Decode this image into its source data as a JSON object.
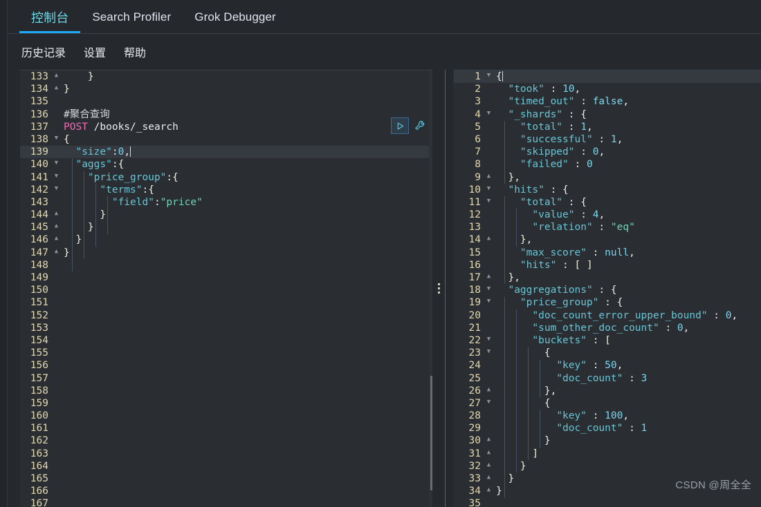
{
  "window": {
    "background": "#25282c",
    "accent": "#1ba9f5",
    "active_tab_color": "#6bd8e8"
  },
  "tabs": [
    {
      "label": "控制台",
      "active": true,
      "name": "tab-console"
    },
    {
      "label": "Search Profiler",
      "active": false,
      "name": "tab-search-profiler"
    },
    {
      "label": "Grok Debugger",
      "active": false,
      "name": "tab-grok-debugger"
    }
  ],
  "menu": [
    {
      "label": "历史记录",
      "name": "menu-history"
    },
    {
      "label": "设置",
      "name": "menu-settings"
    },
    {
      "label": "帮助",
      "name": "menu-help"
    }
  ],
  "actions": {
    "play_title": "Click to send request",
    "wrench_title": "Open documentation / options",
    "play_icon": "play-icon",
    "wrench_icon": "wrench-icon"
  },
  "request_editor": {
    "name": "request-editor",
    "first_line_number": 133,
    "highlighted_line": 139,
    "lines": [
      {
        "n": 133,
        "fold": "up",
        "tokens": [
          {
            "t": "    ",
            "c": ""
          },
          {
            "t": "}",
            "c": "c-punc"
          }
        ]
      },
      {
        "n": 134,
        "fold": "up",
        "tokens": [
          {
            "t": "}",
            "c": "c-punc"
          }
        ]
      },
      {
        "n": 135,
        "fold": "",
        "tokens": []
      },
      {
        "n": 136,
        "fold": "",
        "tokens": [
          {
            "t": "#聚合查询",
            "c": "c-cmt"
          }
        ]
      },
      {
        "n": 137,
        "fold": "",
        "tokens": [
          {
            "t": "POST",
            "c": "c-meth"
          },
          {
            "t": " /books/_search",
            "c": "c-url"
          }
        ]
      },
      {
        "n": 138,
        "fold": "down",
        "tokens": [
          {
            "t": "{",
            "c": "c-punc"
          }
        ]
      },
      {
        "n": 139,
        "fold": "",
        "tokens": [
          {
            "t": "  ",
            "c": ""
          },
          {
            "t": "\"size\"",
            "c": "c-key"
          },
          {
            "t": ":",
            "c": "c-punc"
          },
          {
            "t": "0",
            "c": "c-num"
          },
          {
            "t": ",",
            "c": "c-punc"
          }
        ],
        "caret": true
      },
      {
        "n": 140,
        "fold": "down",
        "tokens": [
          {
            "t": "  ",
            "c": ""
          },
          {
            "t": "\"aggs\"",
            "c": "c-key"
          },
          {
            "t": ":{",
            "c": "c-punc"
          }
        ]
      },
      {
        "n": 141,
        "fold": "down",
        "tokens": [
          {
            "t": "    ",
            "c": ""
          },
          {
            "t": "\"price_group\"",
            "c": "c-key"
          },
          {
            "t": ":{",
            "c": "c-punc"
          }
        ]
      },
      {
        "n": 142,
        "fold": "down",
        "tokens": [
          {
            "t": "      ",
            "c": ""
          },
          {
            "t": "\"terms\"",
            "c": "c-key"
          },
          {
            "t": ":{",
            "c": "c-punc"
          }
        ]
      },
      {
        "n": 143,
        "fold": "",
        "tokens": [
          {
            "t": "        ",
            "c": ""
          },
          {
            "t": "\"field\"",
            "c": "c-key"
          },
          {
            "t": ":",
            "c": "c-punc"
          },
          {
            "t": "\"price\"",
            "c": "c-str"
          }
        ]
      },
      {
        "n": 144,
        "fold": "up",
        "tokens": [
          {
            "t": "      ",
            "c": ""
          },
          {
            "t": "}",
            "c": "c-punc"
          }
        ]
      },
      {
        "n": 145,
        "fold": "up",
        "tokens": [
          {
            "t": "    ",
            "c": ""
          },
          {
            "t": "}",
            "c": "c-punc"
          }
        ]
      },
      {
        "n": 146,
        "fold": "up",
        "tokens": [
          {
            "t": "  ",
            "c": ""
          },
          {
            "t": "}",
            "c": "c-punc"
          }
        ]
      },
      {
        "n": 147,
        "fold": "up",
        "tokens": [
          {
            "t": "}",
            "c": "c-punc"
          }
        ]
      },
      {
        "n": 148,
        "fold": "",
        "tokens": []
      },
      {
        "n": 149,
        "fold": "",
        "tokens": []
      },
      {
        "n": 150,
        "fold": "",
        "tokens": []
      },
      {
        "n": 151,
        "fold": "",
        "tokens": []
      },
      {
        "n": 152,
        "fold": "",
        "tokens": []
      },
      {
        "n": 153,
        "fold": "",
        "tokens": []
      },
      {
        "n": 154,
        "fold": "",
        "tokens": []
      },
      {
        "n": 155,
        "fold": "",
        "tokens": []
      },
      {
        "n": 156,
        "fold": "",
        "tokens": []
      },
      {
        "n": 157,
        "fold": "",
        "tokens": []
      },
      {
        "n": 158,
        "fold": "",
        "tokens": []
      },
      {
        "n": 159,
        "fold": "",
        "tokens": []
      },
      {
        "n": 160,
        "fold": "",
        "tokens": []
      },
      {
        "n": 161,
        "fold": "",
        "tokens": []
      },
      {
        "n": 162,
        "fold": "",
        "tokens": []
      },
      {
        "n": 163,
        "fold": "",
        "tokens": []
      },
      {
        "n": 164,
        "fold": "",
        "tokens": []
      },
      {
        "n": 165,
        "fold": "",
        "tokens": []
      },
      {
        "n": 166,
        "fold": "",
        "tokens": []
      },
      {
        "n": 167,
        "fold": "",
        "tokens": []
      }
    ]
  },
  "response_editor": {
    "name": "response-editor",
    "highlighted_line": 1,
    "lines": [
      {
        "n": 1,
        "fold": "down",
        "tokens": [
          {
            "t": "{",
            "c": "c-punc"
          }
        ],
        "caret": true
      },
      {
        "n": 2,
        "fold": "",
        "tokens": [
          {
            "t": "  ",
            "c": ""
          },
          {
            "t": "\"took\"",
            "c": "c-key"
          },
          {
            "t": " : ",
            "c": "c-punc"
          },
          {
            "t": "10",
            "c": "c-num"
          },
          {
            "t": ",",
            "c": "c-punc"
          }
        ]
      },
      {
        "n": 3,
        "fold": "",
        "tokens": [
          {
            "t": "  ",
            "c": ""
          },
          {
            "t": "\"timed_out\"",
            "c": "c-key"
          },
          {
            "t": " : ",
            "c": "c-punc"
          },
          {
            "t": "false",
            "c": "c-bool"
          },
          {
            "t": ",",
            "c": "c-punc"
          }
        ]
      },
      {
        "n": 4,
        "fold": "down",
        "tokens": [
          {
            "t": "  ",
            "c": ""
          },
          {
            "t": "\"_shards\"",
            "c": "c-key"
          },
          {
            "t": " : {",
            "c": "c-punc"
          }
        ]
      },
      {
        "n": 5,
        "fold": "",
        "tokens": [
          {
            "t": "    ",
            "c": ""
          },
          {
            "t": "\"total\"",
            "c": "c-key"
          },
          {
            "t": " : ",
            "c": "c-punc"
          },
          {
            "t": "1",
            "c": "c-num"
          },
          {
            "t": ",",
            "c": "c-punc"
          }
        ]
      },
      {
        "n": 6,
        "fold": "",
        "tokens": [
          {
            "t": "    ",
            "c": ""
          },
          {
            "t": "\"successful\"",
            "c": "c-key"
          },
          {
            "t": " : ",
            "c": "c-punc"
          },
          {
            "t": "1",
            "c": "c-num"
          },
          {
            "t": ",",
            "c": "c-punc"
          }
        ]
      },
      {
        "n": 7,
        "fold": "",
        "tokens": [
          {
            "t": "    ",
            "c": ""
          },
          {
            "t": "\"skipped\"",
            "c": "c-key"
          },
          {
            "t": " : ",
            "c": "c-punc"
          },
          {
            "t": "0",
            "c": "c-num"
          },
          {
            "t": ",",
            "c": "c-punc"
          }
        ]
      },
      {
        "n": 8,
        "fold": "",
        "tokens": [
          {
            "t": "    ",
            "c": ""
          },
          {
            "t": "\"failed\"",
            "c": "c-key"
          },
          {
            "t": " : ",
            "c": "c-punc"
          },
          {
            "t": "0",
            "c": "c-num"
          }
        ]
      },
      {
        "n": 9,
        "fold": "up",
        "tokens": [
          {
            "t": "  ",
            "c": ""
          },
          {
            "t": "},",
            "c": "c-punc"
          }
        ]
      },
      {
        "n": 10,
        "fold": "down",
        "tokens": [
          {
            "t": "  ",
            "c": ""
          },
          {
            "t": "\"hits\"",
            "c": "c-key"
          },
          {
            "t": " : {",
            "c": "c-punc"
          }
        ]
      },
      {
        "n": 11,
        "fold": "down",
        "tokens": [
          {
            "t": "    ",
            "c": ""
          },
          {
            "t": "\"total\"",
            "c": "c-key"
          },
          {
            "t": " : {",
            "c": "c-punc"
          }
        ]
      },
      {
        "n": 12,
        "fold": "",
        "tokens": [
          {
            "t": "      ",
            "c": ""
          },
          {
            "t": "\"value\"",
            "c": "c-key"
          },
          {
            "t": " : ",
            "c": "c-punc"
          },
          {
            "t": "4",
            "c": "c-num"
          },
          {
            "t": ",",
            "c": "c-punc"
          }
        ]
      },
      {
        "n": 13,
        "fold": "",
        "tokens": [
          {
            "t": "      ",
            "c": ""
          },
          {
            "t": "\"relation\"",
            "c": "c-key"
          },
          {
            "t": " : ",
            "c": "c-punc"
          },
          {
            "t": "\"eq\"",
            "c": "c-str"
          }
        ]
      },
      {
        "n": 14,
        "fold": "up",
        "tokens": [
          {
            "t": "    ",
            "c": ""
          },
          {
            "t": "},",
            "c": "c-punc"
          }
        ]
      },
      {
        "n": 15,
        "fold": "",
        "tokens": [
          {
            "t": "    ",
            "c": ""
          },
          {
            "t": "\"max_score\"",
            "c": "c-key"
          },
          {
            "t": " : ",
            "c": "c-punc"
          },
          {
            "t": "null",
            "c": "c-null"
          },
          {
            "t": ",",
            "c": "c-punc"
          }
        ]
      },
      {
        "n": 16,
        "fold": "",
        "tokens": [
          {
            "t": "    ",
            "c": ""
          },
          {
            "t": "\"hits\"",
            "c": "c-key"
          },
          {
            "t": " : [ ]",
            "c": "c-punc"
          }
        ]
      },
      {
        "n": 17,
        "fold": "up",
        "tokens": [
          {
            "t": "  ",
            "c": ""
          },
          {
            "t": "},",
            "c": "c-punc"
          }
        ]
      },
      {
        "n": 18,
        "fold": "down",
        "tokens": [
          {
            "t": "  ",
            "c": ""
          },
          {
            "t": "\"aggregations\"",
            "c": "c-key"
          },
          {
            "t": " : {",
            "c": "c-punc"
          }
        ]
      },
      {
        "n": 19,
        "fold": "down",
        "tokens": [
          {
            "t": "    ",
            "c": ""
          },
          {
            "t": "\"price_group\"",
            "c": "c-key"
          },
          {
            "t": " : {",
            "c": "c-punc"
          }
        ]
      },
      {
        "n": 20,
        "fold": "",
        "tokens": [
          {
            "t": "      ",
            "c": ""
          },
          {
            "t": "\"doc_count_error_upper_bound\"",
            "c": "c-key"
          },
          {
            "t": " : ",
            "c": "c-punc"
          },
          {
            "t": "0",
            "c": "c-num"
          },
          {
            "t": ",",
            "c": "c-punc"
          }
        ]
      },
      {
        "n": 21,
        "fold": "",
        "tokens": [
          {
            "t": "      ",
            "c": ""
          },
          {
            "t": "\"sum_other_doc_count\"",
            "c": "c-key"
          },
          {
            "t": " : ",
            "c": "c-punc"
          },
          {
            "t": "0",
            "c": "c-num"
          },
          {
            "t": ",",
            "c": "c-punc"
          }
        ]
      },
      {
        "n": 22,
        "fold": "down",
        "tokens": [
          {
            "t": "      ",
            "c": ""
          },
          {
            "t": "\"buckets\"",
            "c": "c-key"
          },
          {
            "t": " : [",
            "c": "c-punc"
          }
        ]
      },
      {
        "n": 23,
        "fold": "down",
        "tokens": [
          {
            "t": "        ",
            "c": ""
          },
          {
            "t": "{",
            "c": "c-punc"
          }
        ]
      },
      {
        "n": 24,
        "fold": "",
        "tokens": [
          {
            "t": "          ",
            "c": ""
          },
          {
            "t": "\"key\"",
            "c": "c-key"
          },
          {
            "t": " : ",
            "c": "c-punc"
          },
          {
            "t": "50",
            "c": "c-num"
          },
          {
            "t": ",",
            "c": "c-punc"
          }
        ]
      },
      {
        "n": 25,
        "fold": "",
        "tokens": [
          {
            "t": "          ",
            "c": ""
          },
          {
            "t": "\"doc_count\"",
            "c": "c-key"
          },
          {
            "t": " : ",
            "c": "c-punc"
          },
          {
            "t": "3",
            "c": "c-num"
          }
        ]
      },
      {
        "n": 26,
        "fold": "up",
        "tokens": [
          {
            "t": "        ",
            "c": ""
          },
          {
            "t": "},",
            "c": "c-punc"
          }
        ]
      },
      {
        "n": 27,
        "fold": "down",
        "tokens": [
          {
            "t": "        ",
            "c": ""
          },
          {
            "t": "{",
            "c": "c-punc"
          }
        ]
      },
      {
        "n": 28,
        "fold": "",
        "tokens": [
          {
            "t": "          ",
            "c": ""
          },
          {
            "t": "\"key\"",
            "c": "c-key"
          },
          {
            "t": " : ",
            "c": "c-punc"
          },
          {
            "t": "100",
            "c": "c-num"
          },
          {
            "t": ",",
            "c": "c-punc"
          }
        ]
      },
      {
        "n": 29,
        "fold": "",
        "tokens": [
          {
            "t": "          ",
            "c": ""
          },
          {
            "t": "\"doc_count\"",
            "c": "c-key"
          },
          {
            "t": " : ",
            "c": "c-punc"
          },
          {
            "t": "1",
            "c": "c-num"
          }
        ]
      },
      {
        "n": 30,
        "fold": "up",
        "tokens": [
          {
            "t": "        ",
            "c": ""
          },
          {
            "t": "}",
            "c": "c-punc"
          }
        ]
      },
      {
        "n": 31,
        "fold": "up",
        "tokens": [
          {
            "t": "      ",
            "c": ""
          },
          {
            "t": "]",
            "c": "c-punc"
          }
        ]
      },
      {
        "n": 32,
        "fold": "up",
        "tokens": [
          {
            "t": "    ",
            "c": ""
          },
          {
            "t": "}",
            "c": "c-punc"
          }
        ]
      },
      {
        "n": 33,
        "fold": "up",
        "tokens": [
          {
            "t": "  ",
            "c": ""
          },
          {
            "t": "}",
            "c": "c-punc"
          }
        ]
      },
      {
        "n": 34,
        "fold": "up",
        "tokens": [
          {
            "t": "}",
            "c": "c-punc"
          }
        ]
      },
      {
        "n": 35,
        "fold": "",
        "tokens": []
      }
    ]
  },
  "watermark": {
    "text": "CSDN @周全全"
  }
}
